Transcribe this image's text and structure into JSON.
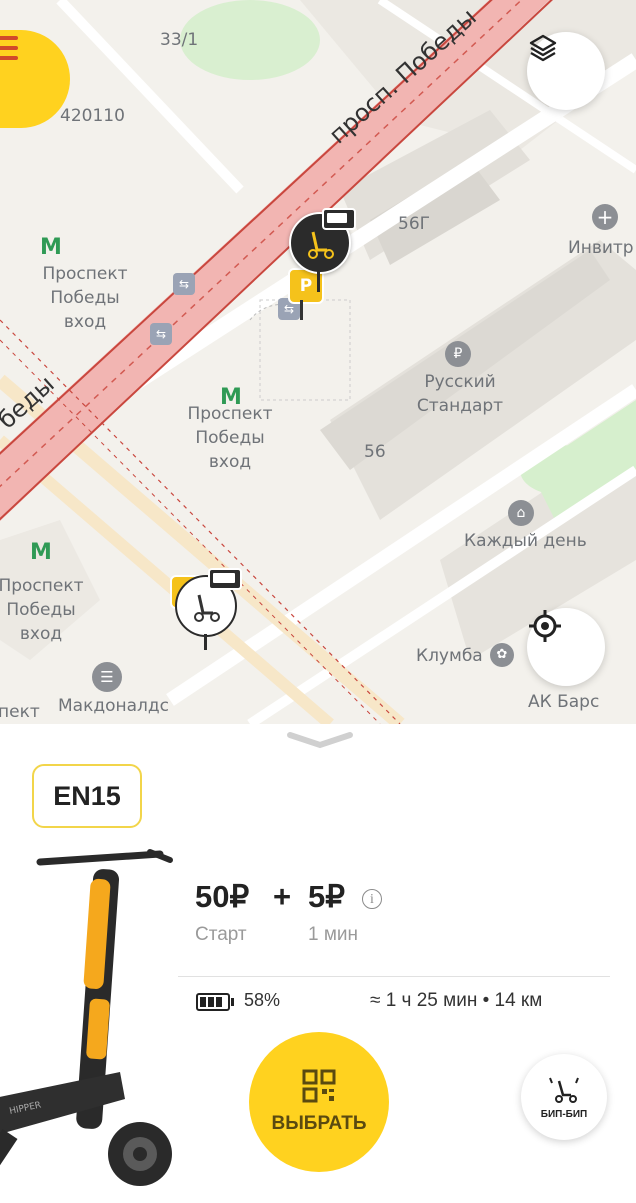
{
  "map": {
    "labels": {
      "house_33_1": "33/1",
      "postcode": "420110",
      "avenue": "просп. Победы",
      "avenue_partial": "беды",
      "house_56g": "56Г",
      "invitro": "Инвитр",
      "metro1": "Проспект\nПобеды\nвход",
      "metro2": "Проспект\nПобеды\nвход",
      "metro3": "Проспект\nПобеды\nвход",
      "russian_standard": "Русский\nСтандарт",
      "house_56": "56",
      "kazhdy_den": "Каждый день",
      "klumba": "Клумба",
      "ak_bars": "АК Барс",
      "mcdonalds": "Макдоналдс",
      "prospect_partial": "пект"
    },
    "icons": {
      "layers": "layers-icon",
      "locate": "crosshair-icon",
      "menu": "menu-lines-icon"
    }
  },
  "sheet": {
    "scooter_code": "EN15",
    "start_price": "50₽",
    "plus": "+",
    "minute_price": "5₽",
    "start_label": "Старт",
    "minute_label": "1 мин",
    "battery_percent": "58%",
    "battery_level": 0.58,
    "range_estimate": "≈ 1 ч 25 мин • 14 км",
    "select_label": "ВЫБРАТЬ",
    "beep_label": "БИП-БИП",
    "scooter_brand": "HIPPER"
  },
  "colors": {
    "accent": "#ffd21f",
    "road_red": "#f2b5b2",
    "road_line": "#c9473e"
  }
}
